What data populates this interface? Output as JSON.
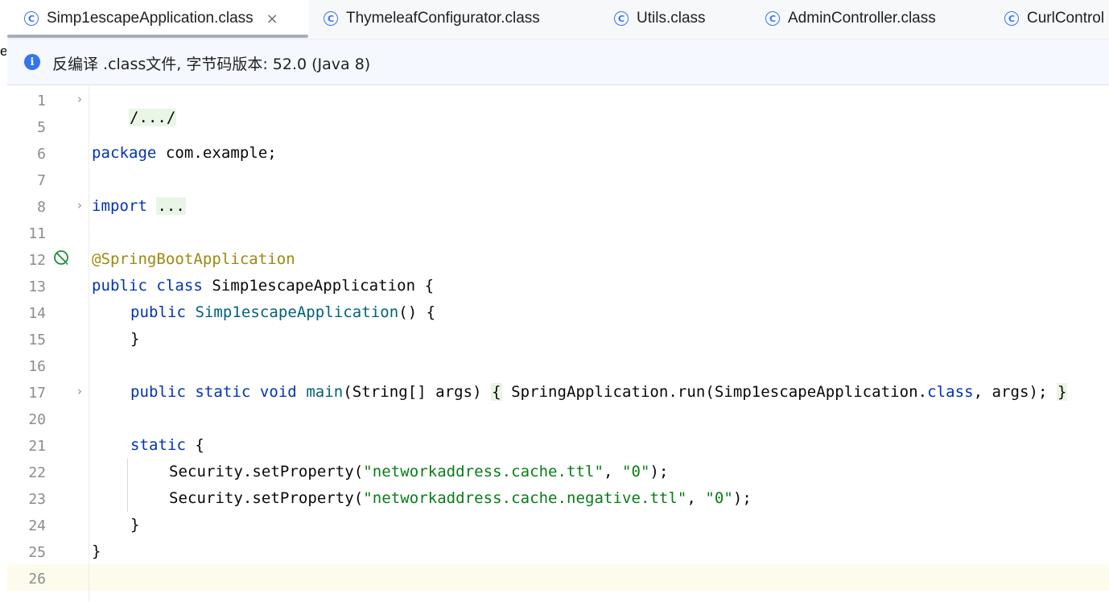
{
  "tabs": [
    {
      "label": "Simp1escapeApplication.class",
      "active": true,
      "close": "×"
    },
    {
      "label": "ThymeleafConfigurator.class",
      "active": false
    },
    {
      "label": "Utils.class",
      "active": false
    },
    {
      "label": "AdminController.class",
      "active": false
    },
    {
      "label": "CurlControl",
      "active": false
    }
  ],
  "tab_icon_letter": "C",
  "edge_glyph": "e",
  "banner": {
    "icon": "info-icon",
    "text": "反编译 .class文件, 字节码版本: 52.0 (Java 8)"
  },
  "colors": {
    "keyword": "#0033b3",
    "annotation": "#9e880d",
    "string": "#067d17",
    "method": "#00627a",
    "accent": "#3574f0",
    "current_line": "#fdfbec"
  },
  "editor": {
    "line_numbers": [
      "1",
      "5",
      "6",
      "7",
      "8",
      "11",
      "12",
      "13",
      "14",
      "15",
      "16",
      "17",
      "20",
      "21",
      "22",
      "23",
      "24",
      "25",
      "26"
    ],
    "lines": {
      "l1": "/.../",
      "l6_kw": "package",
      "l6_rest": " com.example;",
      "l8_kw": "import",
      "l8_fold": "...",
      "l12": "@SpringBootApplication",
      "l13_kw": "public class",
      "l13_rest": " Simp1escapeApplication {",
      "l14_kw": "public",
      "l14_name": "Simp1escapeApplication",
      "l14_rest": "() {",
      "l15": "}",
      "l17_kw": "public static void",
      "l17_main": "main",
      "l17_args": "(String[] args) ",
      "l17_open": "{",
      "l17_body": " SpringApplication.run(Simp1escapeApplication.",
      "l17_class": "class",
      "l17_end": ", args); ",
      "l17_close": "}",
      "l21_kw": "static",
      "l21_rest": " {",
      "l22_pre": "Security.setProperty(",
      "l22_s1": "\"networkaddress.cache.ttl\"",
      "l22_mid": ", ",
      "l22_s2": "\"0\"",
      "l22_end": ");",
      "l23_pre": "Security.setProperty(",
      "l23_s1": "\"networkaddress.cache.negative.ttl\"",
      "l23_mid": ", ",
      "l23_s2": "\"0\"",
      "l23_end": ");",
      "l24": "}",
      "l25": "}"
    }
  }
}
